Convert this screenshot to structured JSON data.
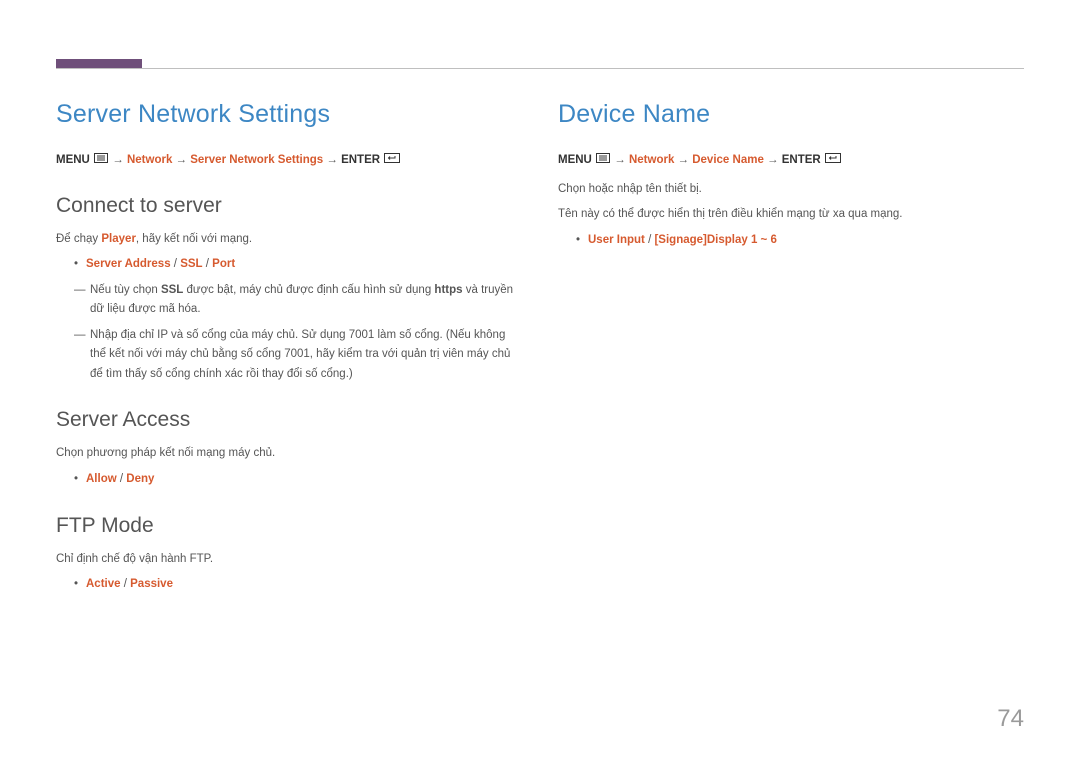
{
  "page_number": "74",
  "colors": {
    "accent_blue": "#3d87c4",
    "accent_orange": "#d65a2f",
    "marker": "#6f4f7a"
  },
  "left": {
    "heading": "Server Network Settings",
    "path": {
      "menu": "MENU",
      "network": "Network",
      "current": "Server Network Settings",
      "enter": "ENTER"
    },
    "connect": {
      "title": "Connect to server",
      "line1_a": "Để chạy ",
      "line1_player": "Player",
      "line1_b": ", hãy kết nối với mạng.",
      "bullet_server_address": "Server Address",
      "bullet_ssl": "SSL",
      "bullet_port": "Port",
      "dash1_a": "Nếu tùy chọn ",
      "dash1_ssl": "SSL",
      "dash1_b": " được bật, máy chủ được định cấu hình sử dụng ",
      "dash1_https": "https",
      "dash1_c": " và truyền dữ liệu được mã hóa.",
      "dash2": "Nhập địa chỉ IP và số cổng của máy chủ. Sử dụng 7001 làm số cổng. (Nếu không thể kết nối với máy chủ bằng số cổng 7001, hãy kiểm tra với quản trị viên máy chủ để tìm thấy số cổng chính xác rồi thay đổi số cổng.)"
    },
    "access": {
      "title": "Server Access",
      "line1": "Chọn phương pháp kết nối mạng máy chủ.",
      "bullet_allow": "Allow",
      "bullet_deny": "Deny"
    },
    "ftp": {
      "title": "FTP Mode",
      "line1": "Chỉ định chế độ vận hành FTP.",
      "bullet_active": "Active",
      "bullet_passive": "Passive"
    }
  },
  "right": {
    "heading": "Device Name",
    "path": {
      "menu": "MENU",
      "network": "Network",
      "current": "Device Name",
      "enter": "ENTER"
    },
    "line1": "Chọn hoặc nhập tên thiết bị.",
    "line2": "Tên này có thể được hiển thị trên điều khiển mạng từ xa qua mạng.",
    "bullet_user_input": "User Input",
    "bullet_signage": "[Signage]Display 1 ~ 6"
  }
}
